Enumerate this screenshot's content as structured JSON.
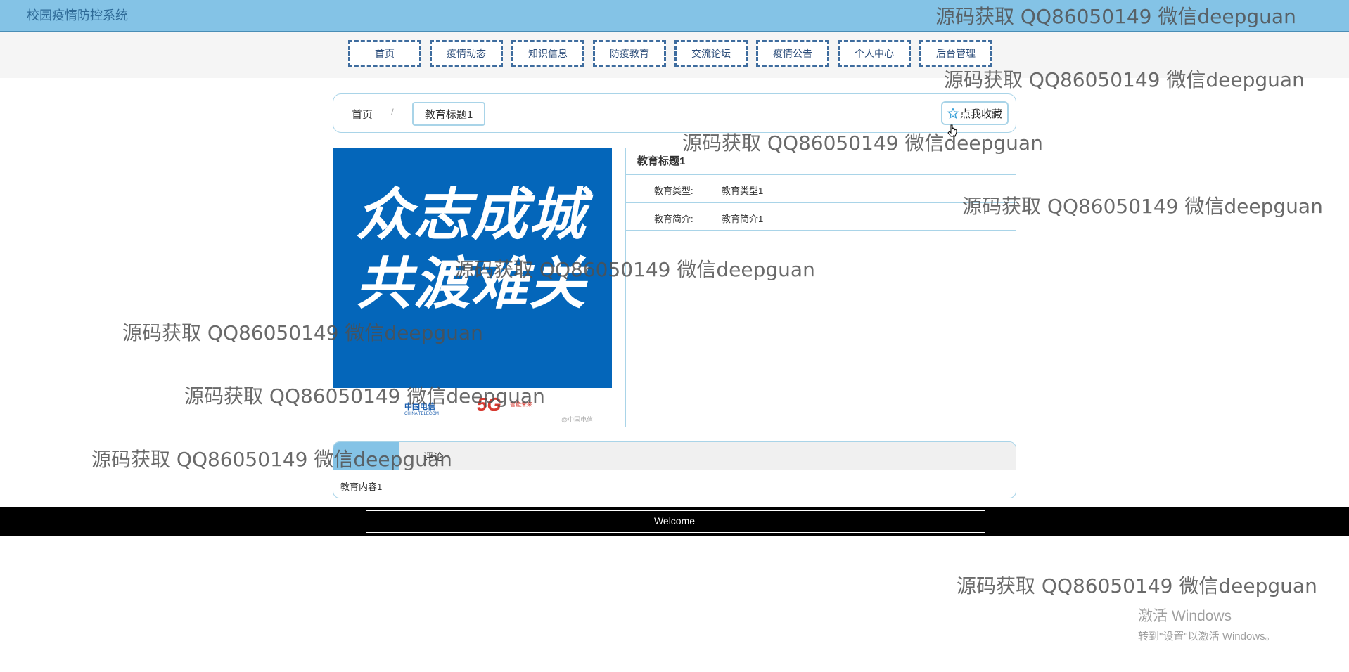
{
  "header": {
    "site_title": "校园疫情防控系统"
  },
  "nav": {
    "items": [
      "首页",
      "疫情动态",
      "知识信息",
      "防疫教育",
      "交流论坛",
      "疫情公告",
      "个人中心",
      "后台管理"
    ]
  },
  "breadcrumb": {
    "home": "首页",
    "separator": "/",
    "current": "教育标题1"
  },
  "favorite_button": {
    "label": "点我收藏",
    "icon": "star-icon"
  },
  "poster": {
    "line1": "众志成城",
    "line2": "共渡难关",
    "telecom_label": "中国电信",
    "telecom_sub": "CHINA TELECOM",
    "fiveg": "5G",
    "fiveg_sub": "智能未来",
    "weibo_tag": "@中国电信",
    "colors": {
      "background": "#0466ba"
    }
  },
  "detail": {
    "title": "教育标题1",
    "fields": [
      {
        "label": "教育类型:",
        "value": "教育类型1"
      },
      {
        "label": "教育简介:",
        "value": "教育简介1"
      }
    ]
  },
  "tabs": {
    "active_label": "",
    "comment_label": "评论",
    "content": "教育内容1"
  },
  "footer": {
    "text": "Welcome"
  },
  "watermark": {
    "text": "源码获取 QQ86050149 微信deepguan"
  },
  "os_notice": {
    "title": "激活 Windows",
    "subtitle": "转到\"设置\"以激活 Windows。"
  },
  "colors": {
    "accent": "#84c3e6",
    "nav_border": "#3e6c9e",
    "panel_border": "#a9d4e8"
  }
}
